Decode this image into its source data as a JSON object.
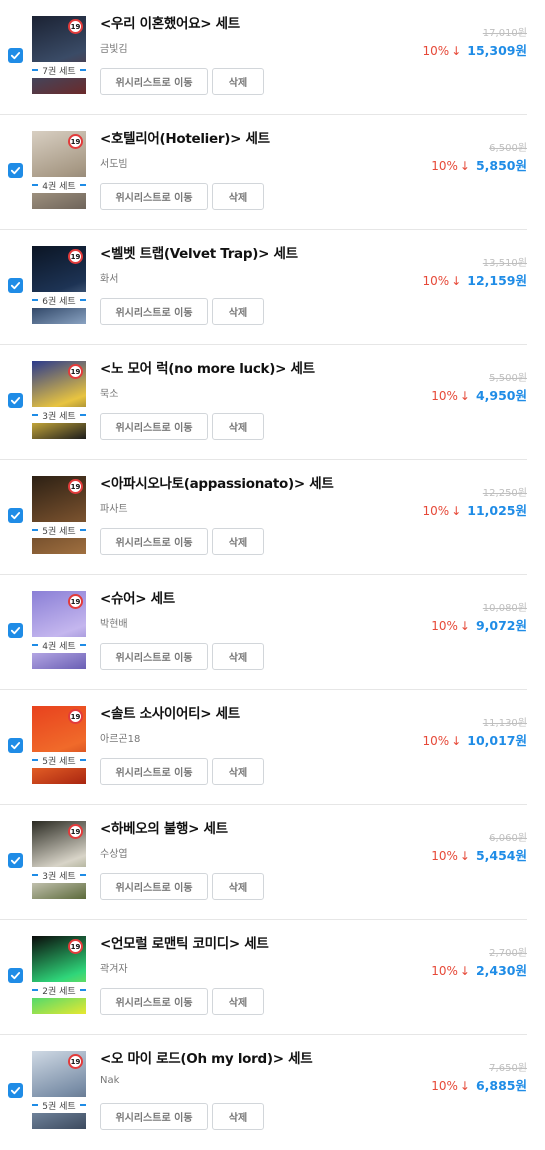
{
  "colors": {
    "accent": "#1f8ce6",
    "discount": "#e64938",
    "age_badge": "#e23b3b"
  },
  "labels": {
    "wishlist": "위시리스트로 이동",
    "delete": "삭제",
    "age": "19",
    "arrow": "↓"
  },
  "items": [
    {
      "title": "<우리 이혼했어요> 세트",
      "author": "금빛김",
      "volumes": "7권 세트",
      "original_price": "17,010원",
      "discount": "10%",
      "price": "15,309원",
      "checked": true,
      "cover_colors": [
        "#1b2233",
        "#3a4b66",
        "#6b2a2a"
      ]
    },
    {
      "title": "<호텔리어(Hotelier)> 세트",
      "author": "서도빔",
      "volumes": "4권 세트",
      "original_price": "6,500원",
      "discount": "10%",
      "price": "5,850원",
      "checked": true,
      "cover_colors": [
        "#d8cfc2",
        "#a89a86",
        "#6e645a"
      ]
    },
    {
      "title": "<벨벳 트랩(Velvet Trap)> 세트",
      "author": "화서",
      "volumes": "6권 세트",
      "original_price": "13,510원",
      "discount": "10%",
      "price": "12,159원",
      "checked": true,
      "cover_colors": [
        "#0b1524",
        "#1d3354",
        "#8aa3c2"
      ]
    },
    {
      "title": "<노 모어 럭(no more luck)> 세트",
      "author": "묵소",
      "volumes": "3권 세트",
      "original_price": "5,500원",
      "discount": "10%",
      "price": "4,950원",
      "checked": true,
      "cover_colors": [
        "#2b3a8c",
        "#e8c440",
        "#1c1c1c"
      ]
    },
    {
      "title": "<아파시오나토(appassionato)> 세트",
      "author": "파사트",
      "volumes": "5권 세트",
      "original_price": "12,250원",
      "discount": "10%",
      "price": "11,025원",
      "checked": true,
      "cover_colors": [
        "#2c2014",
        "#6e4a2a",
        "#a07040"
      ]
    },
    {
      "title": "<슈어> 세트",
      "author": "박현배",
      "volumes": "4권 세트",
      "original_price": "10,080원",
      "discount": "10%",
      "price": "9,072원",
      "checked": true,
      "cover_colors": [
        "#8a7fd6",
        "#c4b6ee",
        "#6a5fb4"
      ]
    },
    {
      "title": "<솔트 소사이어티> 세트",
      "author": "아르곤18",
      "volumes": "5권 세트",
      "original_price": "11,130원",
      "discount": "10%",
      "price": "10,017원",
      "checked": true,
      "cover_colors": [
        "#e8421e",
        "#f06a2a",
        "#a82510"
      ]
    },
    {
      "title": "<하베오의 불행> 세트",
      "author": "수상엽",
      "volumes": "3권 세트",
      "original_price": "6,060원",
      "discount": "10%",
      "price": "5,454원",
      "checked": true,
      "cover_colors": [
        "#2a2a22",
        "#d8d4c8",
        "#5c6a3a"
      ]
    },
    {
      "title": "<언모럴 로맨틱 코미디> 세트",
      "author": "곽겨자",
      "volumes": "2권 세트",
      "original_price": "2,700원",
      "discount": "10%",
      "price": "2,430원",
      "checked": true,
      "cover_colors": [
        "#0a0a0a",
        "#2fd67a",
        "#e8e830"
      ]
    },
    {
      "title": "<오 마이 로드(Oh my lord)> 세트",
      "author": "Nak",
      "volumes": "5권 세트",
      "original_price": "7,650원",
      "discount": "10%",
      "price": "6,885원",
      "checked": true,
      "cover_colors": [
        "#cfd9e4",
        "#7b8fa8",
        "#3c4a5e"
      ]
    }
  ]
}
